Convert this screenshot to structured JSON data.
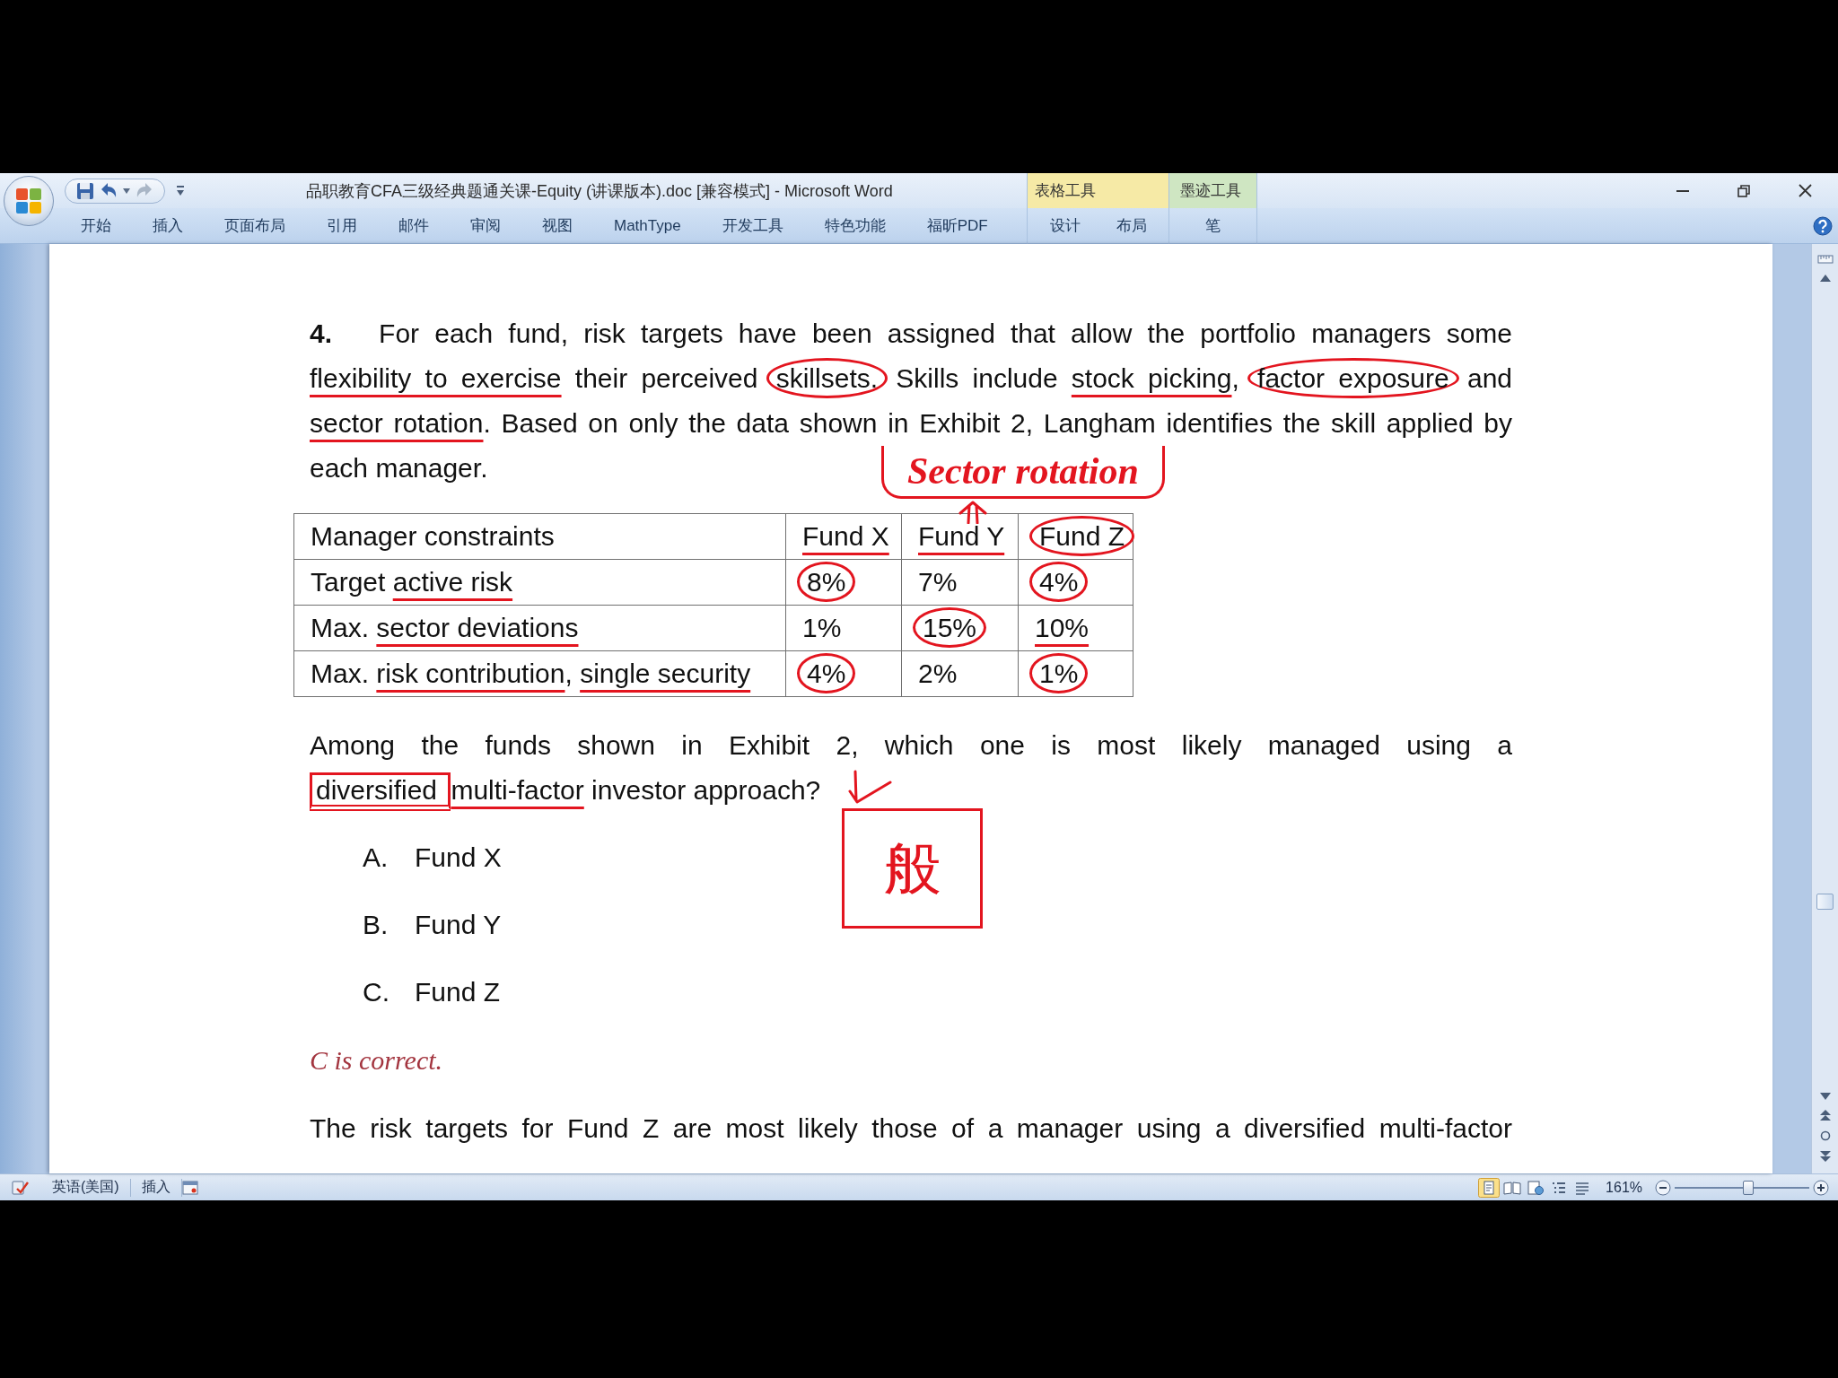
{
  "window": {
    "title": "品职教育CFA三级经典题通关课-Equity (讲课版本).doc [兼容模式] - Microsoft Word"
  },
  "ribbon": {
    "tabs": [
      {
        "label": "开始",
        "selected": false
      },
      {
        "label": "插入",
        "selected": false
      },
      {
        "label": "页面布局",
        "selected": false
      },
      {
        "label": "引用",
        "selected": false
      },
      {
        "label": "邮件",
        "selected": false
      },
      {
        "label": "审阅",
        "selected": false
      },
      {
        "label": "视图",
        "selected": false
      },
      {
        "label": "MathType",
        "selected": false
      },
      {
        "label": "开发工具",
        "selected": false
      },
      {
        "label": "特色功能",
        "selected": false
      },
      {
        "label": "福昕PDF",
        "selected": false
      }
    ],
    "context_groups": [
      {
        "title": "表格工具",
        "color": "#f6eaa6",
        "tabs": [
          {
            "label": "设计",
            "selected": false
          },
          {
            "label": "布局",
            "selected": false
          }
        ]
      },
      {
        "title": "墨迹工具",
        "color": "#cfe6c2",
        "tabs": [
          {
            "label": "笔",
            "selected": false
          }
        ]
      }
    ]
  },
  "document": {
    "question": {
      "number": "4.",
      "segments": [
        {
          "text": "For each fund, risk targets have been assigned that allow the portfolio managers some ",
          "kind": "plain"
        },
        {
          "text": "flexibility to exercise",
          "kind": "underlined"
        },
        {
          "text": " their perceived ",
          "kind": "plain"
        },
        {
          "text": "skillsets.",
          "kind": "circled"
        },
        {
          "text": " Skills include ",
          "kind": "plain"
        },
        {
          "text": "stock picking",
          "kind": "underlined"
        },
        {
          "text": ", ",
          "kind": "plain"
        },
        {
          "text": "factor exposure",
          "kind": "circled"
        },
        {
          "text": " and ",
          "kind": "plain"
        },
        {
          "text": "sector rotation",
          "kind": "underlined"
        },
        {
          "text": ". Based on only the data shown in Exhibit 2, Langham identifies the skill applied by each manager.",
          "kind": "plain"
        }
      ]
    },
    "table": {
      "columns": [
        {
          "label": "Manager constraints",
          "kind": "plain"
        },
        {
          "label": "Fund X",
          "kind": "underlined"
        },
        {
          "label": "Fund Y",
          "kind": "underlined"
        },
        {
          "label": "Fund Z",
          "kind": "circled"
        }
      ],
      "rows": [
        {
          "cells": [
            {
              "segments": [
                {
                  "text": "Target ",
                  "kind": "plain"
                },
                {
                  "text": "active risk",
                  "kind": "underlined"
                }
              ]
            },
            {
              "segments": [
                {
                  "text": "8%",
                  "kind": "circled"
                }
              ]
            },
            {
              "segments": [
                {
                  "text": "7%",
                  "kind": "plain"
                }
              ]
            },
            {
              "segments": [
                {
                  "text": "4%",
                  "kind": "circled"
                }
              ]
            }
          ]
        },
        {
          "cells": [
            {
              "segments": [
                {
                  "text": "Max. ",
                  "kind": "plain"
                },
                {
                  "text": "sector deviations",
                  "kind": "underlined"
                }
              ]
            },
            {
              "segments": [
                {
                  "text": "1%",
                  "kind": "plain"
                }
              ]
            },
            {
              "segments": [
                {
                  "text": "15%",
                  "kind": "circled"
                }
              ]
            },
            {
              "segments": [
                {
                  "text": "10%",
                  "kind": "underlined"
                }
              ]
            }
          ]
        },
        {
          "cells": [
            {
              "segments": [
                {
                  "text": "Max. ",
                  "kind": "plain"
                },
                {
                  "text": "risk contribution",
                  "kind": "underlined"
                },
                {
                  "text": ", ",
                  "kind": "plain"
                },
                {
                  "text": "single security",
                  "kind": "underlined"
                }
              ]
            },
            {
              "segments": [
                {
                  "text": "4%",
                  "kind": "circled"
                }
              ]
            },
            {
              "segments": [
                {
                  "text": "2%",
                  "kind": "plain"
                }
              ]
            },
            {
              "segments": [
                {
                  "text": "1%",
                  "kind": "circled"
                }
              ]
            }
          ]
        }
      ]
    },
    "prompt": {
      "segments": [
        {
          "text": "Among the funds shown in Exhibit 2, which one is most likely managed using a ",
          "kind": "plain"
        },
        {
          "text": "diversified ",
          "kind": "boxed"
        },
        {
          "text": "multi-factor",
          "kind": "underlined"
        },
        {
          "text": " investor approach?",
          "kind": "plain"
        }
      ]
    },
    "options": [
      {
        "letter": "A.",
        "text": "Fund X"
      },
      {
        "letter": "B.",
        "text": "Fund Y"
      },
      {
        "letter": "C.",
        "text": "Fund Z"
      }
    ],
    "answer_key": "C is correct.",
    "explanation": "The risk targets for Fund Z are most likely those of a manager using a diversified multi-factor",
    "ink_notes": [
      {
        "text": "Sector rotation"
      },
      {
        "text": "般"
      }
    ]
  },
  "status_bar": {
    "language": "英语(美国)",
    "mode": "插入",
    "view_buttons": [
      {
        "kind": "print",
        "selected": true
      },
      {
        "kind": "reading",
        "selected": false
      },
      {
        "kind": "web",
        "selected": false
      },
      {
        "kind": "outline",
        "selected": false
      },
      {
        "kind": "draft",
        "selected": false
      }
    ],
    "zoom": {
      "reading": "161%",
      "level": 0.55
    }
  }
}
